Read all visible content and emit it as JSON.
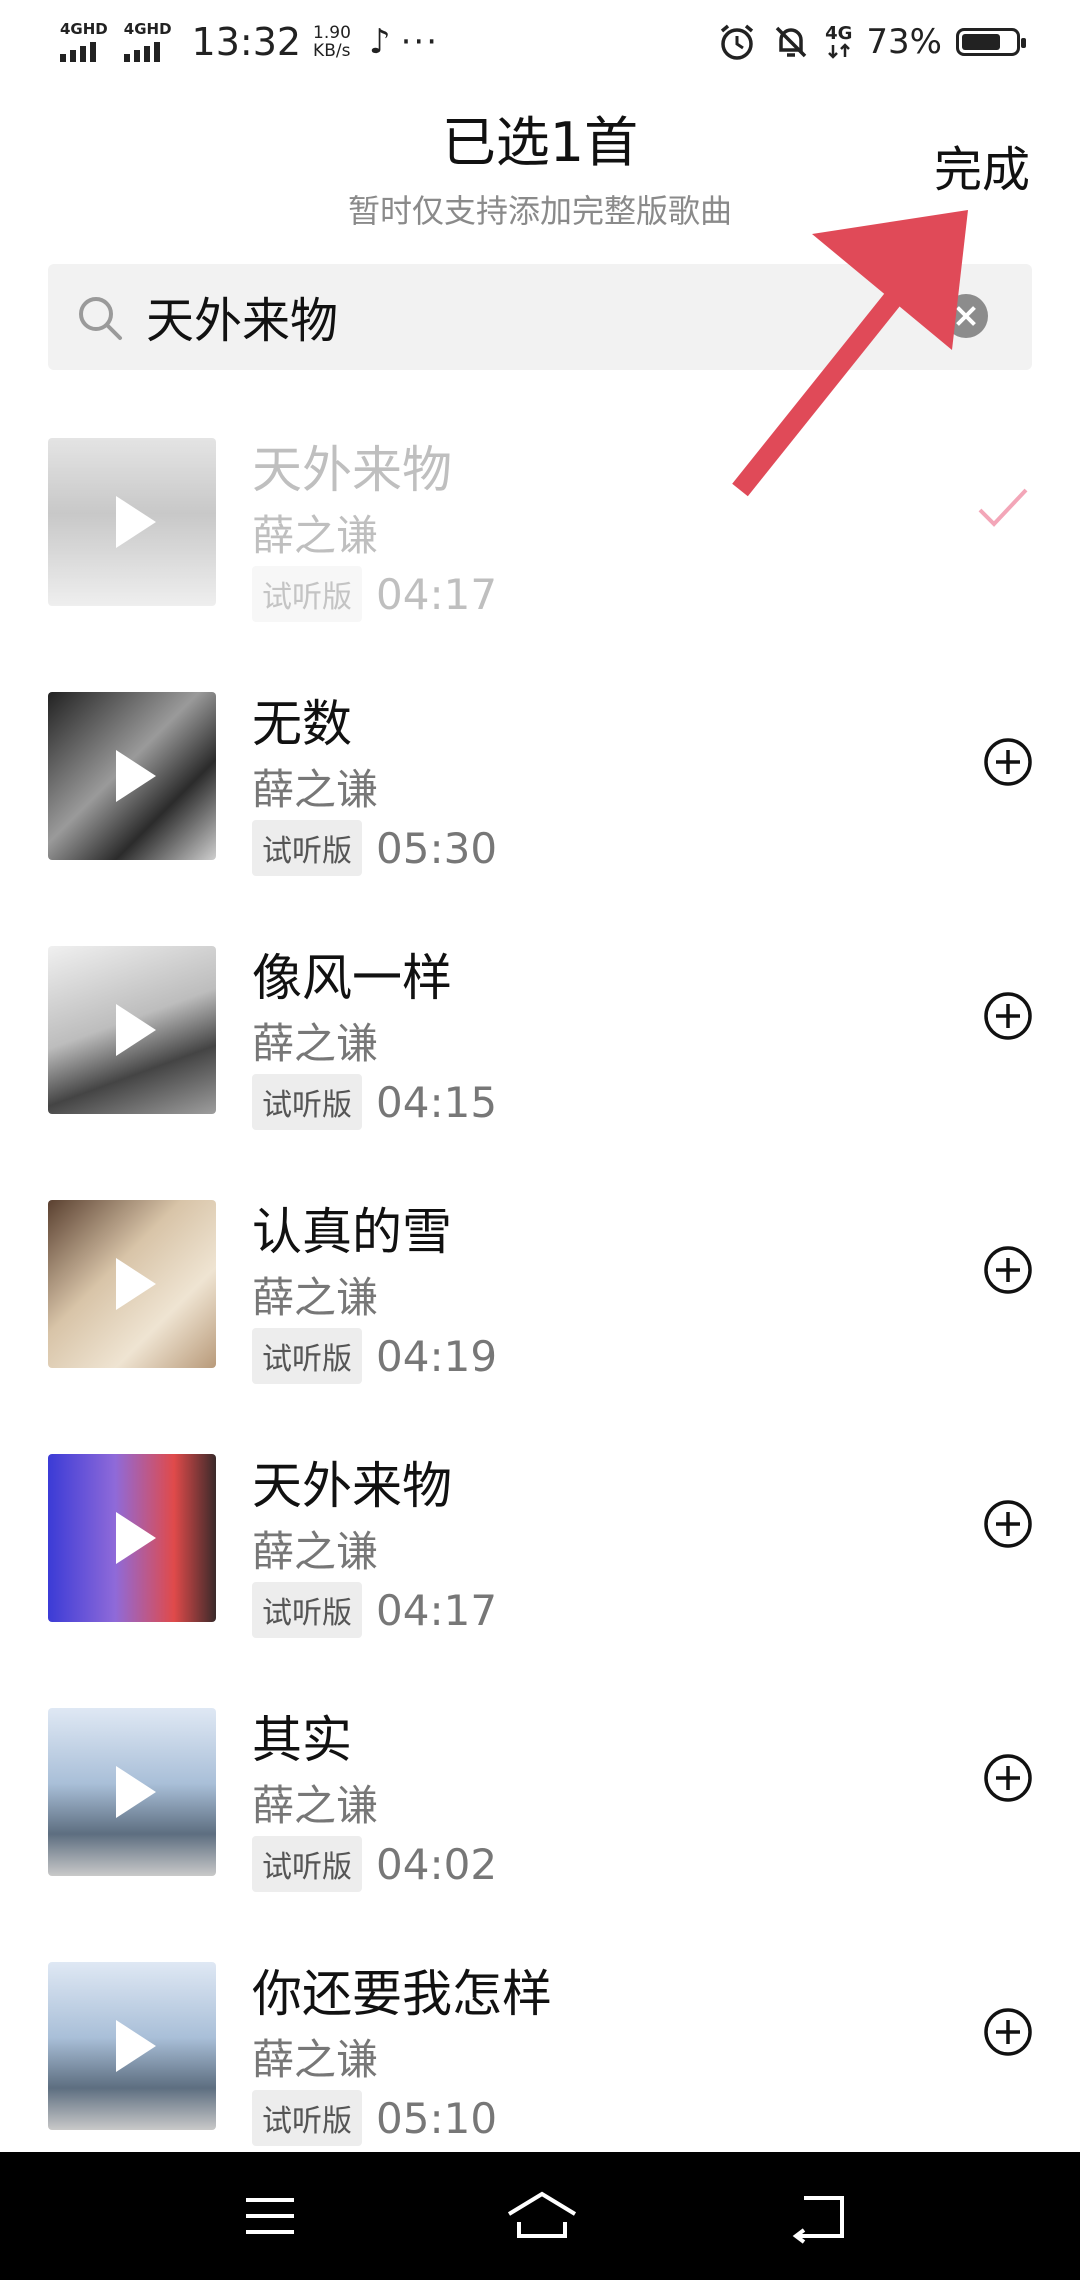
{
  "status_bar": {
    "net1": "4GHD",
    "net2": "4GHD",
    "time": "13:32",
    "speed_value": "1.90",
    "speed_unit": "KB/s",
    "more": "···",
    "net3": "4G",
    "battery": "73%",
    "battery_level": 0.73
  },
  "header": {
    "title": "已选1首",
    "subtitle": "暂时仅支持添加完整版歌曲",
    "done_label": "完成"
  },
  "search": {
    "value": "天外来物"
  },
  "songs": [
    {
      "title": "天外来物",
      "artist": "薛之谦",
      "tag": "试听版",
      "duration": "04:17",
      "selected": true
    },
    {
      "title": "无数",
      "artist": "薛之谦",
      "tag": "试听版",
      "duration": "05:30",
      "selected": false
    },
    {
      "title": "像风一样",
      "artist": "薛之谦",
      "tag": "试听版",
      "duration": "04:15",
      "selected": false
    },
    {
      "title": "认真的雪",
      "artist": "薛之谦",
      "tag": "试听版",
      "duration": "04:19",
      "selected": false
    },
    {
      "title": "天外来物",
      "artist": "薛之谦",
      "tag": "试听版",
      "duration": "04:17",
      "selected": false
    },
    {
      "title": "其实",
      "artist": "薛之谦",
      "tag": "试听版",
      "duration": "04:02",
      "selected": false
    },
    {
      "title": "你还要我怎样",
      "artist": "薛之谦",
      "tag": "试听版",
      "duration": "05:10",
      "selected": false
    }
  ],
  "colors": {
    "check": "#f3a6b8",
    "annotation_arrow": "#e04a58"
  }
}
